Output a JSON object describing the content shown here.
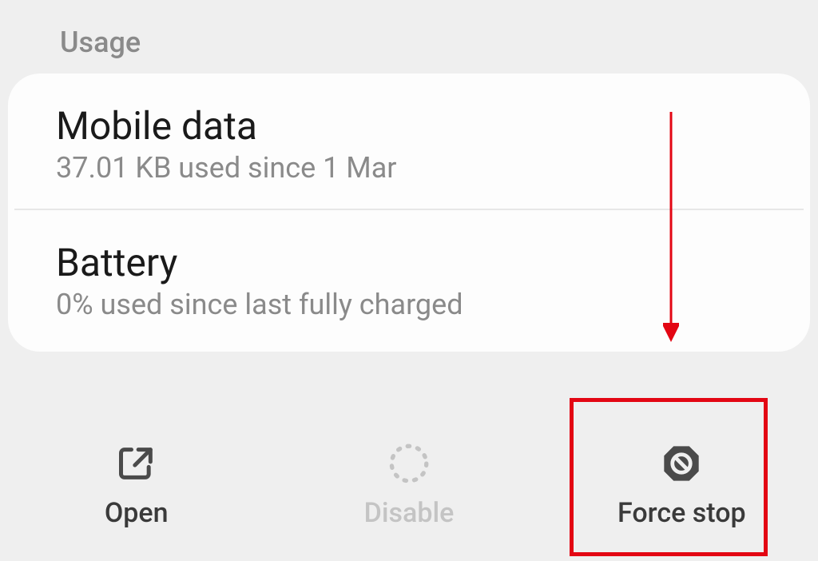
{
  "section": {
    "header": "Usage"
  },
  "rows": {
    "mobile_data": {
      "title": "Mobile data",
      "subtitle": "37.01 KB used since 1 Mar"
    },
    "battery": {
      "title": "Battery",
      "subtitle": "0% used since last fully charged"
    }
  },
  "bottom": {
    "open": "Open",
    "disable": "Disable",
    "force_stop": "Force stop"
  },
  "annotation": {
    "highlight_target": "force-stop-button"
  }
}
